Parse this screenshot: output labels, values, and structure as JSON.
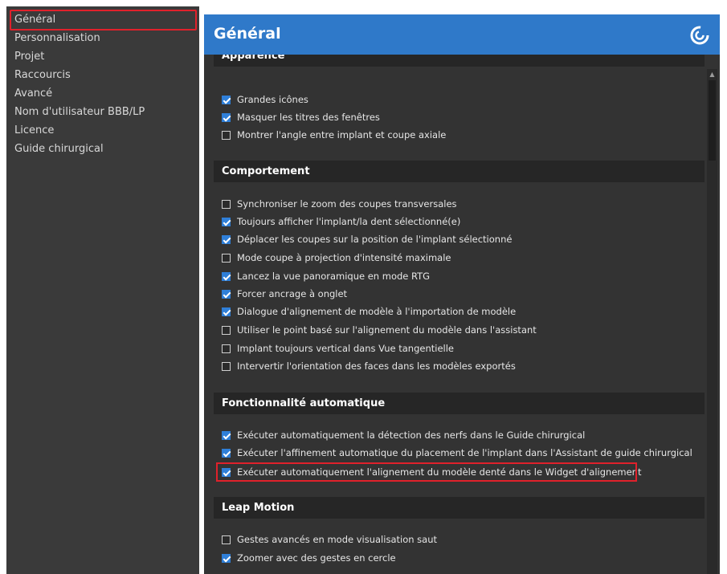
{
  "sidebar": {
    "items": [
      {
        "label": "Général",
        "selected": true
      },
      {
        "label": "Personnalisation"
      },
      {
        "label": "Projet"
      },
      {
        "label": "Raccourcis"
      },
      {
        "label": "Avancé"
      },
      {
        "label": "Nom d'utilisateur BBB/LP"
      },
      {
        "label": "Licence"
      },
      {
        "label": "Guide chirurgical"
      }
    ]
  },
  "header": {
    "title": "Général",
    "accent_color": "#2f79c9",
    "logo_icon": "swirl-logo-icon"
  },
  "sections": {
    "apparence": {
      "title": "Apparence",
      "items": [
        {
          "label": "Grandes icônes",
          "checked": true
        },
        {
          "label": "Masquer les titres des fenêtres",
          "checked": true
        },
        {
          "label": "Montrer l'angle entre implant et coupe axiale",
          "checked": false
        }
      ]
    },
    "comportement": {
      "title": "Comportement",
      "items": [
        {
          "label": "Synchroniser le zoom des coupes transversales",
          "checked": false
        },
        {
          "label": "Toujours afficher l'implant/la dent sélectionné(e)",
          "checked": true
        },
        {
          "label": "Déplacer les coupes sur la position de l'implant sélectionné",
          "checked": true
        },
        {
          "label": "Mode coupe à projection d'intensité maximale",
          "checked": false
        },
        {
          "label": "Lancez la vue panoramique en mode RTG",
          "checked": true
        },
        {
          "label": "Forcer ancrage à onglet",
          "checked": true
        },
        {
          "label": "Dialogue d'alignement de modèle à l'importation de modèle",
          "checked": true
        },
        {
          "label": "Utiliser le point basé sur l'alignement du modèle dans l'assistant",
          "checked": false
        },
        {
          "label": "Implant toujours vertical dans Vue tangentielle",
          "checked": false
        },
        {
          "label": "Intervertir l'orientation des faces dans les modèles exportés",
          "checked": false
        }
      ]
    },
    "fonctionnalite": {
      "title": "Fonctionnalité automatique",
      "items": [
        {
          "label": "Exécuter automatiquement la détection des nerfs dans le Guide chirurgical",
          "checked": true
        },
        {
          "label": "Exécuter l'affinement automatique du placement de l'implant dans l'Assistant de guide chirurgical",
          "checked": true
        },
        {
          "label": "Exécuter automatiquement l'alignement du modèle denté dans le Widget d'alignement",
          "checked": true
        }
      ]
    },
    "leap": {
      "title": "Leap Motion",
      "items": [
        {
          "label": "Gestes avancés en mode visualisation saut",
          "checked": false
        },
        {
          "label": "Zoomer avec des gestes en cercle",
          "checked": true
        }
      ]
    }
  },
  "colors": {
    "highlight": "#e0212b",
    "checkbox_checked": "#2f7fd8"
  }
}
